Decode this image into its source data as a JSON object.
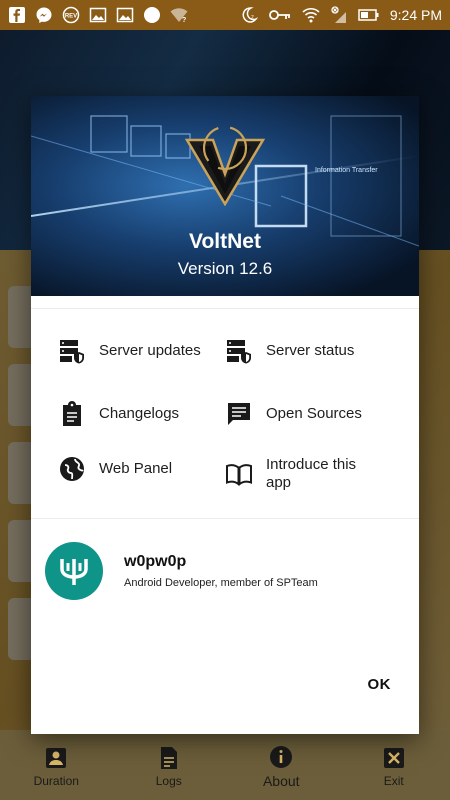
{
  "status_bar": {
    "time": "9:24 PM",
    "left_icons": [
      "facebook-icon",
      "messenger-icon",
      "rev-icon",
      "gallery-icon",
      "gallery-icon",
      "circle-icon",
      "wifi-question-icon"
    ],
    "right_icons": [
      "do-not-disturb-icon",
      "key-icon",
      "wifi-icon",
      "signal-icon",
      "battery-icon"
    ]
  },
  "dialog": {
    "app_name": "VoltNet",
    "version": "Version 12.6",
    "banner_caption": "Information Transfer",
    "items": [
      {
        "label": "Server updates",
        "icon": "server-shield-icon"
      },
      {
        "label": "Server status",
        "icon": "server-shield-icon"
      },
      {
        "label": "Changelogs",
        "icon": "clipboard-icon"
      },
      {
        "label": "Open Sources",
        "icon": "message-icon"
      },
      {
        "label": "Web Panel",
        "icon": "globe-icon"
      },
      {
        "label": "Introduce this app",
        "icon": "book-icon"
      }
    ],
    "developer": {
      "name": "w0pw0p",
      "role": "Android Developer, member of SPTeam"
    },
    "ok_label": "OK"
  },
  "bottom_nav": [
    {
      "label": "Duration",
      "icon": "badge-icon"
    },
    {
      "label": "Logs",
      "icon": "document-icon"
    },
    {
      "label": "About",
      "icon": "info-icon"
    },
    {
      "label": "Exit",
      "icon": "close-box-icon"
    }
  ],
  "colors": {
    "status_bar": "#8a5a17",
    "avatar": "#0e9488",
    "banner": "#173e6e"
  }
}
